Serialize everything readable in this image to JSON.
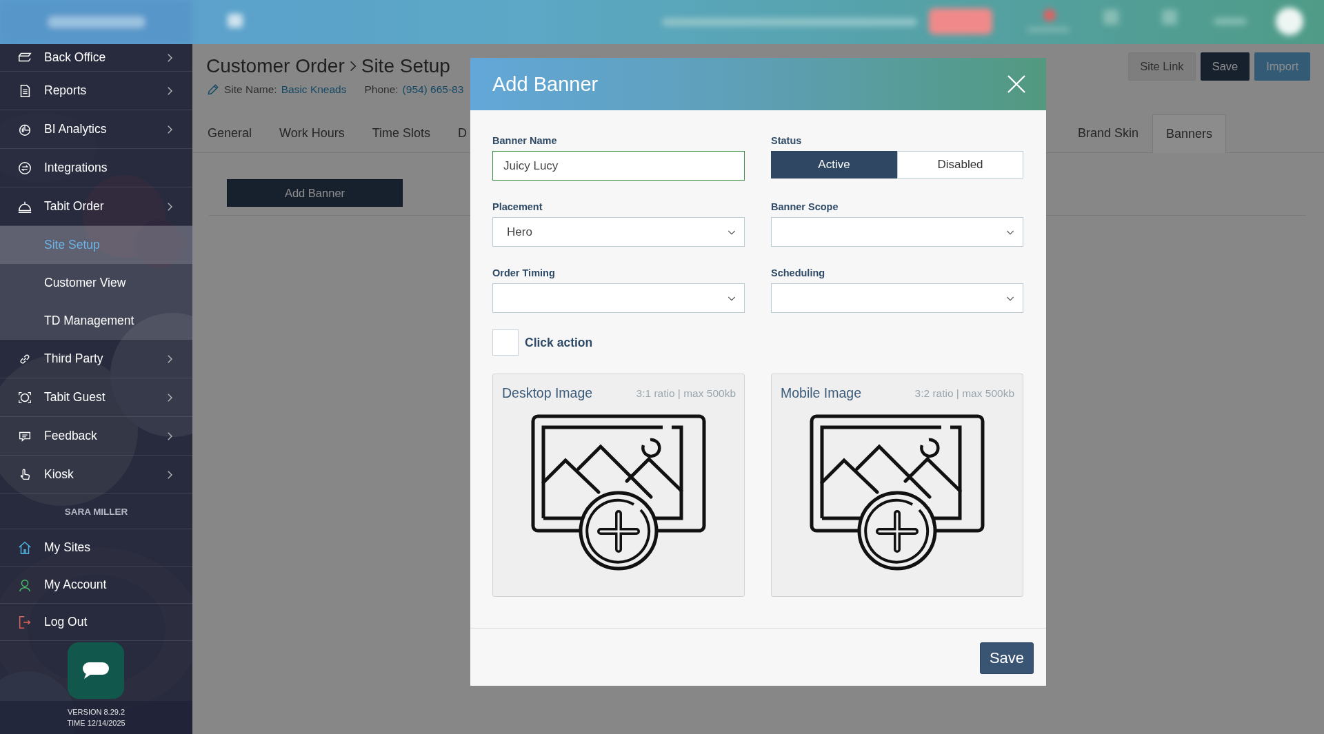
{
  "sidebar": {
    "items": [
      {
        "label": "Back Office",
        "expandable": true
      },
      {
        "label": "Reports",
        "expandable": true
      },
      {
        "label": "BI Analytics",
        "expandable": true
      },
      {
        "label": "Integrations",
        "expandable": false
      },
      {
        "label": "Tabit Order",
        "expandable": true,
        "expanded": true,
        "children": [
          {
            "label": "Site Setup",
            "selected": true
          },
          {
            "label": "Customer View",
            "selected": false
          },
          {
            "label": "TD Management",
            "selected": false
          }
        ]
      },
      {
        "label": "Third Party",
        "expandable": true
      },
      {
        "label": "Tabit Guest",
        "expandable": true
      },
      {
        "label": "Feedback",
        "expandable": true
      },
      {
        "label": "Kiosk",
        "expandable": true
      }
    ],
    "user_name": "SARA MILLER",
    "account_items": [
      {
        "label": "My Sites"
      },
      {
        "label": "My Account"
      },
      {
        "label": "Log Out"
      }
    ],
    "version": "VERSION 8.29.2",
    "time": "TIME 12/14/2025"
  },
  "page": {
    "title_parent": "Customer Order",
    "title": "Site Setup",
    "site_name_label": "Site Name:",
    "site_name": "Basic Kneads",
    "phone_label": "Phone:",
    "phone": "(954) 665-83",
    "buttons": [
      {
        "label": "Site Link",
        "kind": "secondary"
      },
      {
        "label": "Save",
        "kind": "primary"
      },
      {
        "label": "Import",
        "kind": "accent"
      }
    ],
    "tabs": [
      {
        "label": "General",
        "selected": false
      },
      {
        "label": "Work Hours",
        "selected": false
      },
      {
        "label": "Time Slots",
        "selected": false
      },
      {
        "label": "D",
        "selected": false
      },
      {
        "label": "Brand Skin",
        "selected": false
      },
      {
        "label": "Banners",
        "selected": true
      }
    ],
    "add_button": "Add Banner"
  },
  "modal": {
    "title": "Add Banner",
    "banner_name": {
      "label": "Banner Name",
      "value": "Juicy Lucy"
    },
    "status": {
      "label": "Status",
      "options": [
        {
          "label": "Active",
          "selected": true
        },
        {
          "label": "Disabled",
          "selected": false
        }
      ]
    },
    "selects": [
      {
        "label": "Placement",
        "value": "Hero"
      },
      {
        "label": "Banner Scope"
      },
      {
        "label": "Order Timing"
      },
      {
        "label": "Scheduling"
      }
    ],
    "click_action": {
      "label": "Click action",
      "checked": false
    },
    "images": [
      {
        "title": "Desktop Image",
        "hint": "3:1 ratio | max 500kb"
      },
      {
        "title": "Mobile Image",
        "hint": "3:2 ratio | max 500kb"
      }
    ],
    "save": "Save"
  }
}
